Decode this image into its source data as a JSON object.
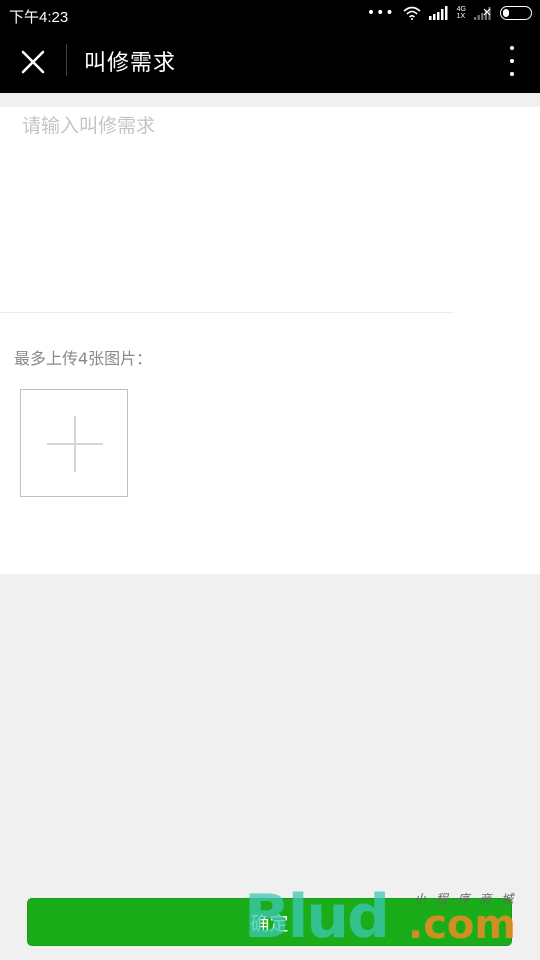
{
  "status_bar": {
    "time": "下午4:23",
    "dots": "•••",
    "network_label_top": "4G",
    "network_label_bottom": "1X"
  },
  "title_bar": {
    "title": "叫修需求",
    "close_icon": "close-icon",
    "more_icon": "more-vertical-icon"
  },
  "form": {
    "request_value": "",
    "request_placeholder": "请输入叫修需求",
    "upload_hint": "最多上传4张图片：",
    "upload_icon": "plus-icon"
  },
  "footer": {
    "confirm_label": "确定"
  },
  "watermark": {
    "big_text": "Blud",
    "com_text": ".com",
    "small_text": "小 程 序 商 城"
  },
  "colors": {
    "primary": "#1aad19",
    "bar_bg": "#000000",
    "page_bg": "#f0f0f0",
    "placeholder": "#c4c4c4",
    "hint_text": "#8a8a8a"
  }
}
